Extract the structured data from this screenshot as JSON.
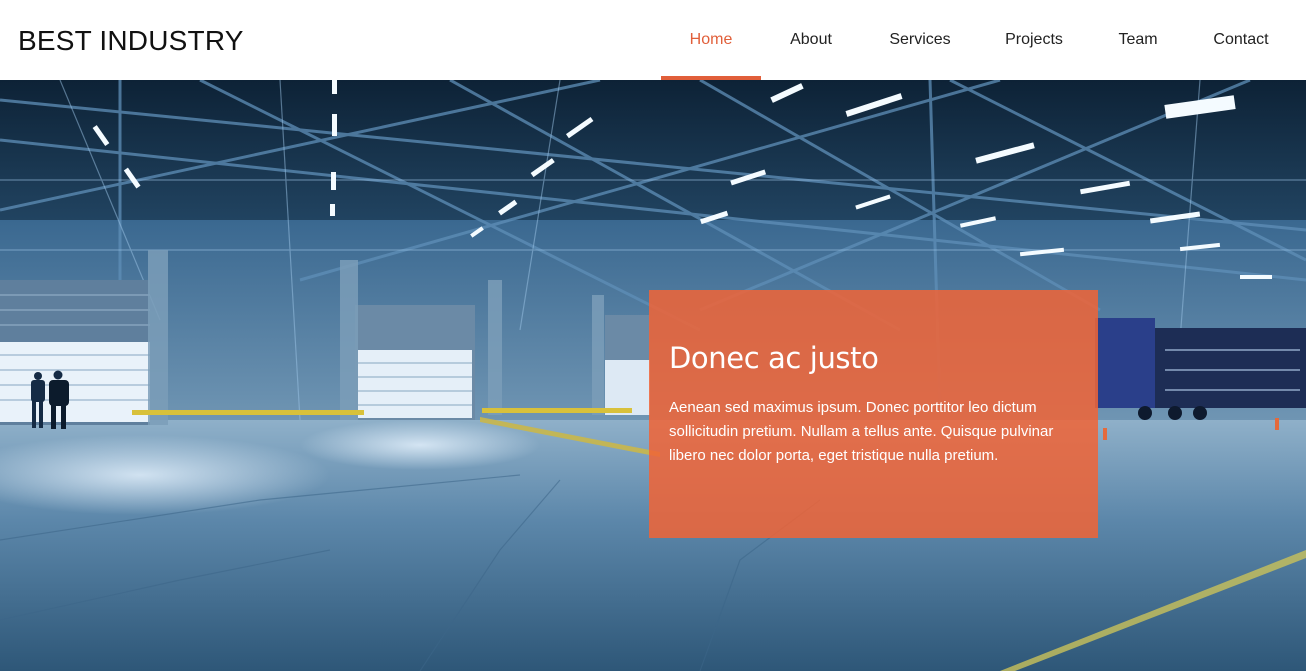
{
  "brand": {
    "name": "BEST INDUSTRY"
  },
  "nav": {
    "items": [
      {
        "label": "Home",
        "active": true
      },
      {
        "label": "About",
        "active": false
      },
      {
        "label": "Services",
        "active": false
      },
      {
        "label": "Projects",
        "active": false
      },
      {
        "label": "Team",
        "active": false
      },
      {
        "label": "Contact",
        "active": false
      }
    ]
  },
  "hero": {
    "caption_title": "Donec ac justo",
    "caption_text": "Aenean sed maximus ipsum. Donec porttitor leo dictum sollicitudin pretium. Nullam a tellus ante. Quisque pulvinar libero nec dolor porta, eget tristique nulla pretium."
  },
  "colors": {
    "accent": "#e15f3a",
    "caption_bg": "#f06437",
    "nav_bg": "#ffffff",
    "hero_tint": "#2b5577"
  }
}
